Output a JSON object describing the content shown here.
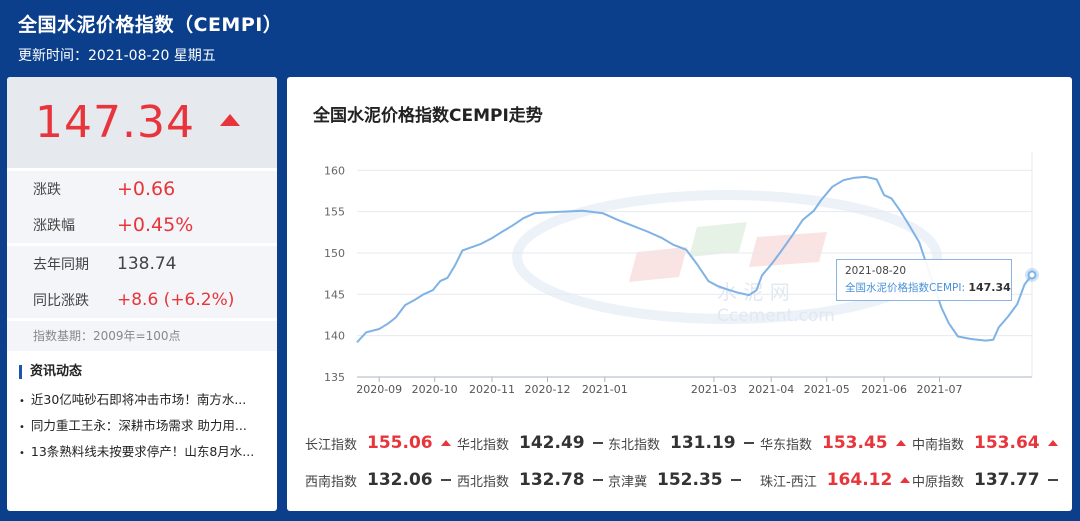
{
  "header": {
    "title": "全国水泥价格指数（CEMPI）",
    "updated": "更新时间：2021-08-20 星期五"
  },
  "summary": {
    "value": "147.34",
    "change_label": "涨跌",
    "change_value": "+0.66",
    "change_pct_label": "涨跌幅",
    "change_pct_value": "+0.45%",
    "lastyear_label": "去年同期",
    "lastyear_value": "138.74",
    "yoy_label": "同比涨跌",
    "yoy_value": "+8.6 (+6.2%)",
    "base": "指数基期：2009年=100点"
  },
  "news": {
    "title": "资讯动态",
    "items": [
      "近30亿吨砂石即将冲击市场！南方水...",
      "同力重工王永：深耕市场需求 助力用...",
      "13条熟料线未按要求停产！山东8月水..."
    ]
  },
  "chart_title": "全国水泥价格指数CEMPI走势",
  "tooltip": {
    "date": "2021-08-20",
    "label": "全国水泥价格指数CEMPI:",
    "value": "147.34"
  },
  "watermark": {
    "brand": "水 泥 网",
    "site": "Ccement.com"
  },
  "chart_data": {
    "type": "line",
    "series_name": "全国水泥价格指数CEMPI",
    "y_ticks": [
      "135",
      "140",
      "145",
      "150",
      "155",
      "160"
    ],
    "x_ticks": [
      "2020-09",
      "2020-10",
      "2020-11",
      "2020-12",
      "2021-01",
      "2021-03",
      "2021-04",
      "2021-05",
      "2021-06",
      "2021-07"
    ],
    "ylim": [
      135,
      161
    ],
    "x_range": [
      "2020-08-20",
      "2021-08-20"
    ],
    "grid": true,
    "color": "#7fb2e5",
    "points": [
      [
        "2020-08-20",
        139.2
      ],
      [
        "2020-08-25",
        140.4
      ],
      [
        "2020-09-01",
        140.8
      ],
      [
        "2020-09-06",
        141.5
      ],
      [
        "2020-09-10",
        142.2
      ],
      [
        "2020-09-15",
        143.7
      ],
      [
        "2020-09-20",
        144.3
      ],
      [
        "2020-09-25",
        145.0
      ],
      [
        "2020-09-30",
        145.5
      ],
      [
        "2020-10-04",
        146.6
      ],
      [
        "2020-10-08",
        147.0
      ],
      [
        "2020-10-12",
        148.5
      ],
      [
        "2020-10-16",
        150.3
      ],
      [
        "2020-10-21",
        150.7
      ],
      [
        "2020-10-26",
        151.1
      ],
      [
        "2020-11-01",
        151.8
      ],
      [
        "2020-11-06",
        152.5
      ],
      [
        "2020-11-12",
        153.3
      ],
      [
        "2020-11-18",
        154.2
      ],
      [
        "2020-11-24",
        154.8
      ],
      [
        "2020-12-01",
        154.9
      ],
      [
        "2020-12-10",
        155.0
      ],
      [
        "2020-12-20",
        155.1
      ],
      [
        "2020-12-31",
        154.8
      ],
      [
        "2021-01-08",
        154.0
      ],
      [
        "2021-01-16",
        153.3
      ],
      [
        "2021-01-24",
        152.6
      ],
      [
        "2021-02-01",
        151.8
      ],
      [
        "2021-02-07",
        151.0
      ],
      [
        "2021-02-14",
        150.4
      ],
      [
        "2021-02-20",
        148.6
      ],
      [
        "2021-02-26",
        146.6
      ],
      [
        "2021-03-03",
        146.0
      ],
      [
        "2021-03-08",
        145.6
      ],
      [
        "2021-03-14",
        145.2
      ],
      [
        "2021-03-20",
        144.9
      ],
      [
        "2021-03-24",
        145.5
      ],
      [
        "2021-03-27",
        147.3
      ],
      [
        "2021-04-01",
        148.6
      ],
      [
        "2021-04-06",
        150.1
      ],
      [
        "2021-04-12",
        152.0
      ],
      [
        "2021-04-18",
        154.0
      ],
      [
        "2021-04-24",
        155.1
      ],
      [
        "2021-04-28",
        156.4
      ],
      [
        "2021-05-04",
        158.0
      ],
      [
        "2021-05-10",
        158.8
      ],
      [
        "2021-05-16",
        159.1
      ],
      [
        "2021-05-22",
        159.2
      ],
      [
        "2021-05-28",
        158.9
      ],
      [
        "2021-06-01",
        157.0
      ],
      [
        "2021-06-05",
        156.6
      ],
      [
        "2021-06-10",
        155.0
      ],
      [
        "2021-06-15",
        153.2
      ],
      [
        "2021-06-20",
        151.3
      ],
      [
        "2021-06-24",
        148.6
      ],
      [
        "2021-06-28",
        146.0
      ],
      [
        "2021-07-02",
        143.4
      ],
      [
        "2021-07-06",
        141.5
      ],
      [
        "2021-07-11",
        139.9
      ],
      [
        "2021-07-18",
        139.6
      ],
      [
        "2021-07-26",
        139.4
      ],
      [
        "2021-07-30",
        139.5
      ],
      [
        "2021-08-02",
        141.0
      ],
      [
        "2021-08-07",
        142.3
      ],
      [
        "2021-08-12",
        143.8
      ],
      [
        "2021-08-16",
        146.2
      ],
      [
        "2021-08-20",
        147.34
      ]
    ]
  },
  "sub_indices": [
    {
      "name": "长江指数",
      "value": "155.06",
      "trend": "up"
    },
    {
      "name": "华北指数",
      "value": "142.49",
      "trend": "flat"
    },
    {
      "name": "东北指数",
      "value": "131.19",
      "trend": "flat"
    },
    {
      "name": "华东指数",
      "value": "153.45",
      "trend": "up"
    },
    {
      "name": "中南指数",
      "value": "153.64",
      "trend": "up"
    },
    {
      "name": "西南指数",
      "value": "132.06",
      "trend": "flat"
    },
    {
      "name": "西北指数",
      "value": "132.78",
      "trend": "flat"
    },
    {
      "name": "京津冀",
      "value": "152.35",
      "trend": "flat"
    },
    {
      "name": "珠江-西江",
      "value": "164.12",
      "trend": "up"
    },
    {
      "name": "中原指数",
      "value": "137.77",
      "trend": "flat"
    }
  ],
  "colors": {
    "background": "#0b3f8c",
    "up": "#e8353b",
    "line": "#7fb2e5"
  }
}
